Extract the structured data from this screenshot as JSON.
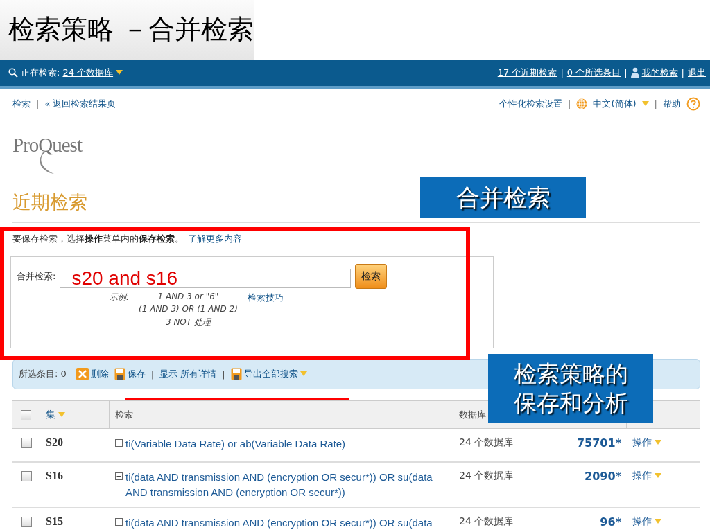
{
  "slide_title": "检索策略 －合并检索",
  "separator": "|",
  "top_bar": {
    "searching_label": "正在检索:",
    "databases_link": "24 个数据库",
    "links": [
      {
        "label": "17 个近期检索",
        "kind": "link"
      },
      {
        "label": "0 个所选条目",
        "kind": "link"
      },
      {
        "label": "我的检索",
        "kind": "user"
      },
      {
        "label": "退出",
        "kind": "link"
      }
    ]
  },
  "nav": {
    "left": [
      "检索",
      "« 返回检索结果页"
    ],
    "settings": "个性化检索设置",
    "language": "中文(简体)",
    "help": "帮助"
  },
  "logo": "ProQuest",
  "heading": "近期检索",
  "callouts": [
    "合并检索",
    "检索策略的保存和分析"
  ],
  "info": "要保存检索，选择**操作**菜单内的**保存检索**。",
  "info_link": "了解更多内容",
  "combine": {
    "label": "合并检索:",
    "value": "s20 and s16",
    "button": "检索",
    "examples_label": "示例:",
    "examples": [
      "1 AND 3 or \"6\"",
      "(1 AND 3) OR (1 AND 2)",
      "3 NOT 处理"
    ],
    "tips_link": "检索技巧"
  },
  "toolbar": {
    "selected": "所选条目: 0",
    "actions": [
      {
        "kind": "delete",
        "label": "删除"
      },
      {
        "kind": "save",
        "label": "保存"
      },
      {
        "kind": "text",
        "label": "显示 所有详情"
      },
      {
        "kind": "export",
        "label": "导出全部搜索"
      }
    ]
  },
  "table": {
    "select_all_checked": false,
    "columns": [
      "集",
      "检索",
      "数据库"
    ],
    "rows": [
      {
        "checked": false,
        "set": "S20",
        "query": "ti(Variable Data Rate) or ab(Variable Data Rate)",
        "databases": "24 个数据库",
        "results": "75701*",
        "action": "操作"
      },
      {
        "checked": false,
        "set": "S16",
        "query": "ti(data AND transmission AND (encryption OR secur*)) OR su(data AND transmission AND (encryption OR secur*))",
        "databases": "24 个数据库",
        "results": "2090*",
        "action": "操作"
      },
      {
        "checked": false,
        "set": "S15",
        "query": "ti(data AND transmission AND (encryption OR secur*)) OR su(data",
        "databases": "24 个数据库",
        "results": "96*",
        "action": "操作"
      }
    ]
  }
}
